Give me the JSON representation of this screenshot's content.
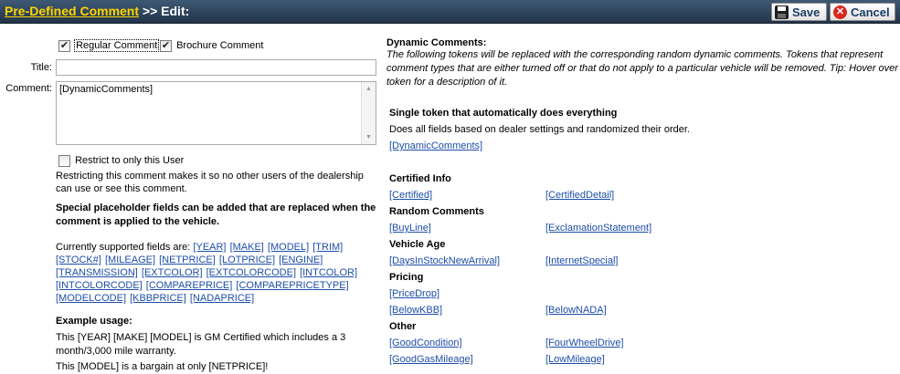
{
  "header": {
    "title_link": "Pre-Defined Comment",
    "title_suffix": " >> Edit:",
    "save_label": "Save",
    "cancel_label": "Cancel"
  },
  "form": {
    "regular_comment_label": "Regular Comment",
    "regular_comment_checked": true,
    "brochure_comment_label": "Brochure Comment",
    "brochure_comment_checked": true,
    "title_label": "Title:",
    "title_value": "",
    "comment_label": "Comment:",
    "comment_value": "[DynamicComments]",
    "restrict_label": "Restrict to only this User",
    "restrict_checked": false,
    "restrict_note": "Restricting this comment makes it so no other users of the dealership can use or see this comment.",
    "placeholder_heading": "Special placeholder fields can be added that are replaced when the comment is applied to the vehicle.",
    "supported_prefix": "Currently supported fields are: ",
    "supported_fields": [
      "[YEAR]",
      "[MAKE]",
      "[MODEL]",
      "[TRIM]",
      "[STOCK#]",
      "[MILEAGE]",
      "[NETPRICE]",
      "[LOTPRICE]",
      "[ENGINE]",
      "[TRANSMISSION]",
      "[EXTCOLOR]",
      "[EXTCOLORCODE]",
      "[INTCOLOR]",
      "[INTCOLORCODE]",
      "[COMPAREPRICE]",
      "[COMPAREPRICETYPE]",
      "[MODELCODE]",
      "[KBBPRICE]",
      "[NADAPRICE]"
    ],
    "example_heading": "Example usage:",
    "example_1": "This [YEAR] [MAKE] [MODEL] is GM Certified which includes a 3 month/3,000 mile warranty.",
    "example_2": "This [MODEL] is a bargain at only [NETPRICE]!"
  },
  "dynamic": {
    "heading": "Dynamic Comments:",
    "description": "The following tokens will be replaced with the corresponding random dynamic comments. Tokens that represent comment types that are either turned off or that do not apply to a particular vehicle will be removed. Tip: Hover over token for a description of it.",
    "single_heading": "Single token that automatically does everything",
    "single_desc": "Does all fields based on dealer settings and randomized their order.",
    "single_token": "[DynamicComments]",
    "sections": {
      "certified": {
        "title": "Certified Info",
        "tokens": [
          "[Certified]",
          "[CertifiedDetail]"
        ]
      },
      "random": {
        "title": "Random Comments",
        "tokens": [
          "[BuyLine]",
          "[ExclamationStatement]"
        ]
      },
      "age": {
        "title": "Vehicle Age",
        "tokens": [
          "[DaysInStockNewArrival]",
          "[InternetSpecial]"
        ]
      },
      "pricing": {
        "title": "Pricing",
        "tokens": [
          "[PriceDrop]",
          "[BelowKBB]",
          "[BelowNADA]"
        ]
      },
      "other": {
        "title": "Other",
        "tokens": [
          "[GoodCondition]",
          "[FourWheelDrive]",
          "[GoodGasMileage]",
          "[LowMileage]"
        ]
      }
    }
  },
  "icons": {
    "save": "floppy-disk-icon",
    "cancel": "x-circle-icon",
    "check": "checkmark-icon"
  },
  "colors": {
    "header_bg": "#2e4560",
    "title_link": "#ffd400",
    "token_link": "#1d4ea8",
    "cancel_icon": "#d8261c"
  }
}
